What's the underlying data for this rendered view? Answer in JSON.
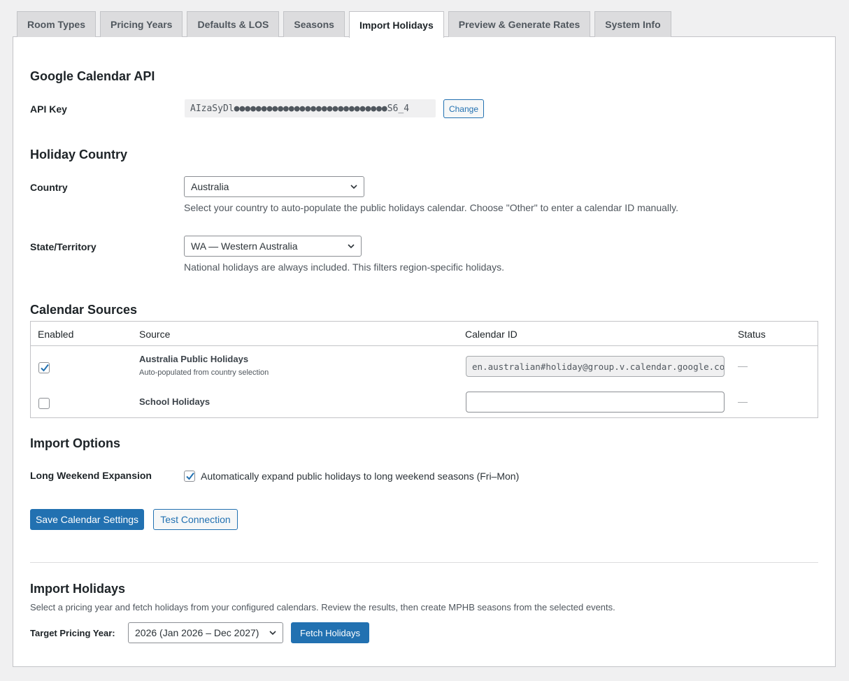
{
  "tabs": [
    {
      "label": "Room Types",
      "active": false
    },
    {
      "label": "Pricing Years",
      "active": false
    },
    {
      "label": "Defaults & LOS",
      "active": false
    },
    {
      "label": "Seasons",
      "active": false
    },
    {
      "label": "Import Holidays",
      "active": true
    },
    {
      "label": "Preview & Generate Rates",
      "active": false
    },
    {
      "label": "System Info",
      "active": false
    }
  ],
  "api_section": {
    "heading": "Google Calendar API",
    "api_key_label": "API Key",
    "api_key_value": "AIzaSyDl●●●●●●●●●●●●●●●●●●●●●●●●●●●●S6_4",
    "change_label": "Change"
  },
  "country_section": {
    "heading": "Holiday Country",
    "country_label": "Country",
    "country_value": "Australia",
    "country_desc": "Select your country to auto-populate the public holidays calendar. Choose \"Other\" to enter a calendar ID manually.",
    "state_label": "State/Territory",
    "state_value": "WA — Western Australia",
    "state_desc": "National holidays are always included. This filters region-specific holidays."
  },
  "sources": {
    "heading": "Calendar Sources",
    "columns": [
      "Enabled",
      "Source",
      "Calendar ID",
      "Status"
    ],
    "rows": [
      {
        "enabled": true,
        "title": "Australia Public Holidays",
        "subtitle": "Auto-populated from country selection",
        "calendar_id": "en.australian#holiday@group.v.calendar.google.com",
        "status": "—"
      },
      {
        "enabled": false,
        "title": "School Holidays",
        "subtitle": "",
        "calendar_id": "",
        "status": "—"
      }
    ]
  },
  "import_options": {
    "heading": "Import Options",
    "long_weekend_label": "Long Weekend Expansion",
    "long_weekend_checked": true,
    "long_weekend_text": "Automatically expand public holidays to long weekend seasons (Fri–Mon)"
  },
  "actions": {
    "save_label": "Save Calendar Settings",
    "test_label": "Test Connection"
  },
  "import_holidays": {
    "heading": "Import Holidays",
    "desc": "Select a pricing year and fetch holidays from your configured calendars. Review the results, then create MPHB seasons from the selected events.",
    "target_label": "Target Pricing Year:",
    "target_value": "2026 (Jan 2026 – Dec 2027)",
    "fetch_label": "Fetch Holidays"
  },
  "colors": {
    "primary": "#2271b1",
    "tab_inactive": "#dcdcde",
    "background": "#f0f0f1"
  },
  "icons": [
    "chevron-down-icon",
    "checkmark-icon"
  ]
}
